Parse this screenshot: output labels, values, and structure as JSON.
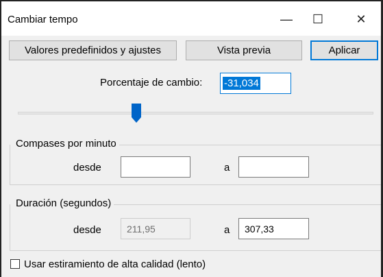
{
  "window": {
    "title": "Cambiar tempo"
  },
  "titlebar": {
    "minimize_glyph": "—",
    "maximize_glyph": "☐",
    "close_glyph": "✕"
  },
  "toolbar": {
    "presets_label": "Valores predefinidos y ajustes",
    "preview_label": "Vista previa",
    "apply_label": "Aplicar"
  },
  "percent": {
    "label": "Porcentaje de cambio:",
    "value": "-31,034"
  },
  "slider": {
    "level": 0.33
  },
  "bpm": {
    "title": "Compases por minuto",
    "from_label": "desde",
    "from_value": "",
    "to_label": "a",
    "to_value": ""
  },
  "duration": {
    "title": "Duración (segundos)",
    "from_label": "desde",
    "from_value": "211,95",
    "to_label": "a",
    "to_value": "307,33"
  },
  "high_quality": {
    "label": "Usar estiramiento de alta calidad (lento)",
    "checked": false
  },
  "colors": {
    "accent": "#0078d7",
    "slider_thumb": "#0064c8"
  }
}
